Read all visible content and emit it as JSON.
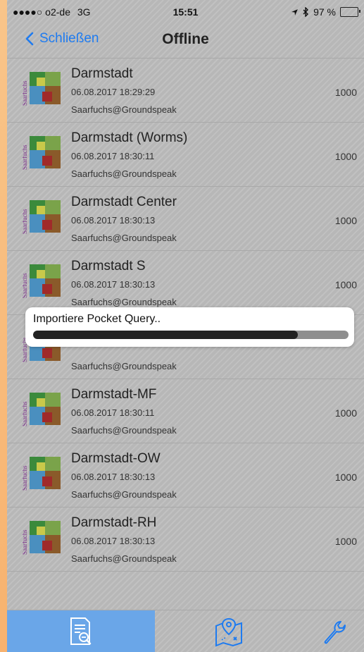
{
  "status_bar": {
    "carrier": "●●●●○ o2-de",
    "network": "3G",
    "time": "15:51",
    "battery_text": "97 %",
    "battery_level": 0.97
  },
  "nav": {
    "back_label": "Schließen",
    "title": "Offline"
  },
  "items": [
    {
      "name": "Darmstadt",
      "date": "06.08.2017 18:29:29",
      "owner": "Saarfuchs@Groundspeak",
      "count": "1000"
    },
    {
      "name": "Darmstadt (Worms)",
      "date": "06.08.2017 18:30:11",
      "owner": "Saarfuchs@Groundspeak",
      "count": "1000"
    },
    {
      "name": "Darmstadt Center",
      "date": "06.08.2017 18:30:13",
      "owner": "Saarfuchs@Groundspeak",
      "count": "1000"
    },
    {
      "name": "Darmstadt S",
      "date": "06.08.2017 18:30:13",
      "owner": "Saarfuchs@Groundspeak",
      "count": "1000"
    },
    {
      "name": "",
      "date": "",
      "owner": "Saarfuchs@Groundspeak",
      "count": ""
    },
    {
      "name": "Darmstadt-MF",
      "date": "06.08.2017 18:30:11",
      "owner": "Saarfuchs@Groundspeak",
      "count": "1000"
    },
    {
      "name": "Darmstadt-OW",
      "date": "06.08.2017 18:30:13",
      "owner": "Saarfuchs@Groundspeak",
      "count": "1000"
    },
    {
      "name": "Darmstadt-RH",
      "date": "06.08.2017 18:30:13",
      "owner": "Saarfuchs@Groundspeak",
      "count": "1000"
    }
  ],
  "thumb_label": "Saarfuchs",
  "progress": {
    "label": "Importiere Pocket Query..",
    "value": 0.84
  },
  "tabs": [
    {
      "icon": "document-search-icon",
      "active": true
    },
    {
      "icon": "map-marker-icon",
      "active": false
    },
    {
      "icon": "wrench-icon",
      "active": false
    }
  ],
  "colors": {
    "accent": "#1e7bf0",
    "active_tab": "#6aa6e8",
    "battery": "#4cd964"
  }
}
